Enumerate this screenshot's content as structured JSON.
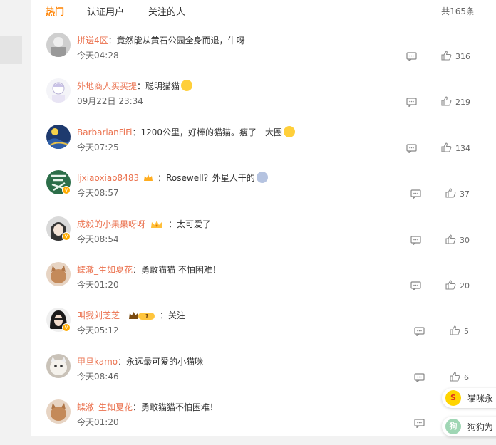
{
  "tabs": [
    "热门",
    "认证用户",
    "关注的人"
  ],
  "total": "共165条",
  "comments": [
    {
      "user": "拼送4区",
      "text": "竟然能从黄石公园全身而退，牛呀",
      "time": "今天04:28",
      "likes": "316"
    },
    {
      "user": "外地商人买买提",
      "text": "聪明猫猫",
      "time": "09月22日 23:34",
      "likes": "219"
    },
    {
      "user": "BarbarianFiFi",
      "text": "1200公里，好棒的猫猫。瘦了一大圈",
      "time": "今天07:25",
      "likes": "134"
    },
    {
      "user": "ljxiaoxiao8483",
      "text": "Rosewell？外星人干的",
      "time": "今天08:57",
      "likes": "37"
    },
    {
      "user": "成毅的小果果呀呀",
      "text": "太可爱了",
      "time": "今天08:54",
      "likes": "30"
    },
    {
      "user": "蝶澈_生如夏花",
      "text": "勇敢猫猫 不怕困难！",
      "time": "今天01:20",
      "likes": "20"
    },
    {
      "user": "叫我刘芝芝_",
      "text": "关注",
      "time": "今天05:12",
      "likes": "5",
      "crown_level": "1"
    },
    {
      "user": "甲旦kamo",
      "text": "永远最可爱的小猫咪",
      "time": "今天08:46",
      "likes": "6"
    },
    {
      "user": "蝶澈_生如夏花",
      "text": "勇敢猫猫不怕困难！",
      "time": "今天01:20",
      "likes": ""
    }
  ],
  "colon": "：",
  "float_chips": [
    {
      "icon_text": "S",
      "label": "猫咪永"
    },
    {
      "icon_text": "狗",
      "label": "狗狗为"
    }
  ],
  "colors": {
    "accent": "#ff8200",
    "username": "#eb7350"
  }
}
